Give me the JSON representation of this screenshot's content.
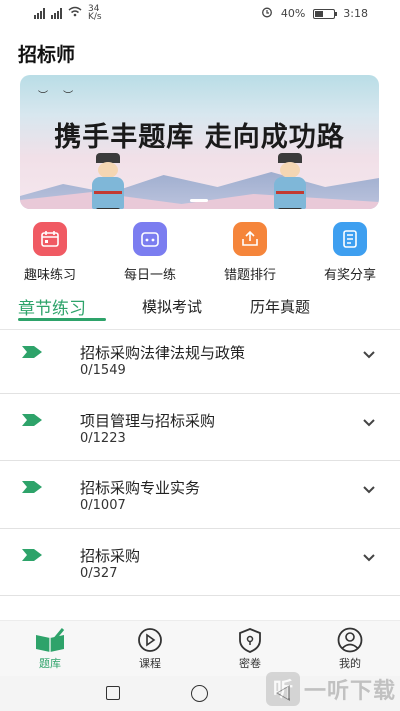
{
  "status_bar": {
    "network_speed_value": "34",
    "network_speed_unit": "K/s",
    "battery": "40%",
    "time": "3:18"
  },
  "app": {
    "title": "招标师"
  },
  "banner": {
    "text": "携手丰题库 走向成功路"
  },
  "quick_nav": [
    {
      "label": "趣味练习",
      "icon": "calendar-icon",
      "color": "#f05a63"
    },
    {
      "label": "每日一练",
      "icon": "calendar-dots-icon",
      "color": "#7b7df0"
    },
    {
      "label": "错题排行",
      "icon": "share-up-icon",
      "color": "#f5853b"
    },
    {
      "label": "有奖分享",
      "icon": "notebook-icon",
      "color": "#3e9ff0"
    }
  ],
  "tabs": [
    {
      "label": "章节练习",
      "active": true
    },
    {
      "label": "模拟考试",
      "active": false
    },
    {
      "label": "历年真题",
      "active": false
    }
  ],
  "chapters": [
    {
      "title": "招标采购法律法规与政策",
      "progress": "0/1549"
    },
    {
      "title": "项目管理与招标采购",
      "progress": "0/1223"
    },
    {
      "title": "招标采购专业实务",
      "progress": "0/1007"
    },
    {
      "title": "招标采购",
      "progress": "0/327"
    }
  ],
  "bottom_nav": [
    {
      "label": "题库",
      "icon": "book-pen-icon",
      "active": true
    },
    {
      "label": "课程",
      "icon": "play-circle-icon",
      "active": false
    },
    {
      "label": "密卷",
      "icon": "lock-shield-icon",
      "active": false
    },
    {
      "label": "我的",
      "icon": "user-icon",
      "active": false
    }
  ],
  "accent_color": "#2ea36a",
  "watermark": {
    "logo": "听",
    "text": "一听下载"
  }
}
